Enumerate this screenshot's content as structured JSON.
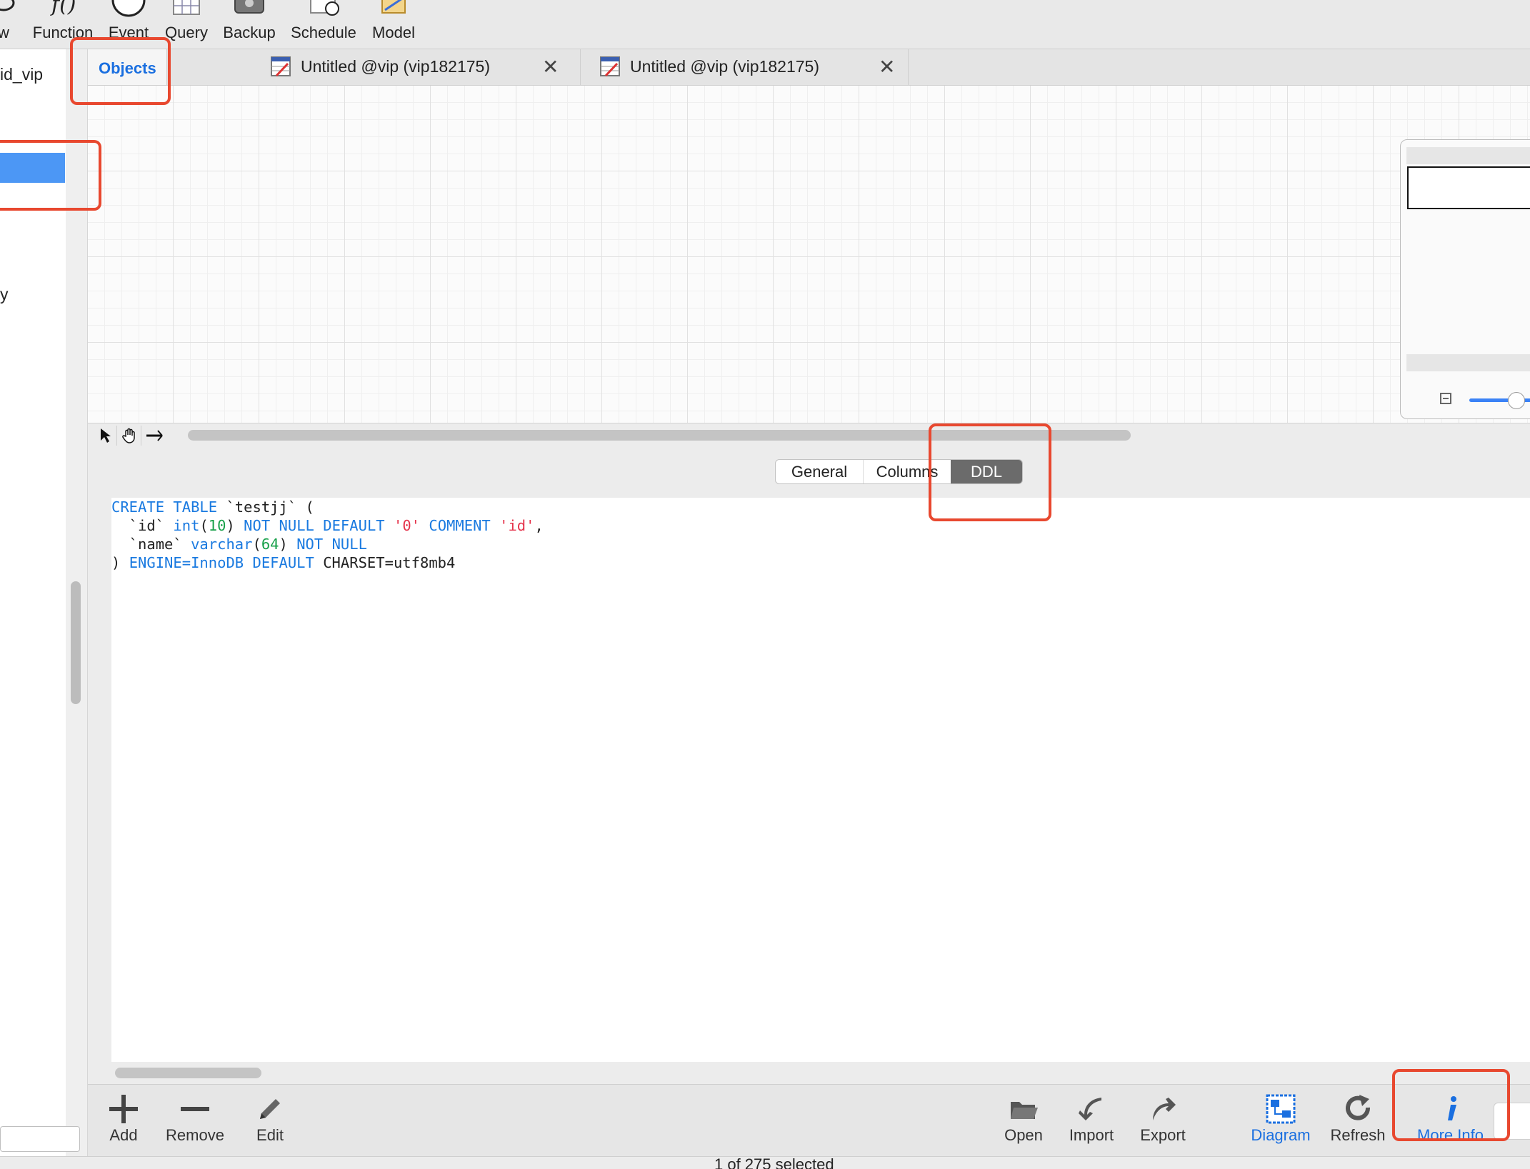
{
  "toolbar": {
    "items": [
      {
        "label": "w",
        "icon": "view-icon"
      },
      {
        "label": "Function",
        "icon": "function-icon"
      },
      {
        "label": "Event",
        "icon": "clock-icon"
      },
      {
        "label": "Query",
        "icon": "query-grid-icon"
      },
      {
        "label": "Backup",
        "icon": "backup-drive-icon"
      },
      {
        "label": "Schedule",
        "icon": "schedule-calendar-icon"
      },
      {
        "label": "Model",
        "icon": "model-ruler-icon"
      }
    ]
  },
  "sidebar": {
    "connection_label": "id_vip",
    "item_label": "y"
  },
  "tabs": [
    {
      "label": "Objects"
    },
    {
      "label": "Untitled @vip (vip182175)",
      "close": "✕"
    },
    {
      "label": "Untitled @vip (vip182175)",
      "close": "✕"
    }
  ],
  "segmented": {
    "general": "General",
    "columns": "Columns",
    "ddl": "DDL",
    "selected": "DDL"
  },
  "ddl": {
    "l1_kw": "CREATE TABLE",
    "l1_rest": " `testjj` (",
    "l2_col": "  `id` ",
    "l2_kw": "int",
    "l2_paren_open": "(",
    "l2_num": "10",
    "l2_paren_close": ") ",
    "l2_kw2": "NOT NULL DEFAULT",
    "l2_str": "'0'",
    "l2_kw3": "COMMENT",
    "l2_str2": "'id'",
    "l2_end": ",",
    "l3_col": "  `name` ",
    "l3_kw": "varchar",
    "l3_paren_open": "(",
    "l3_num": "64",
    "l3_paren_close": ") ",
    "l3_kw2": "NOT NULL",
    "l4_start": ") ",
    "l4_kw": "ENGINE=InnoDB DEFAULT",
    "l4_rest": " CHARSET=utf8mb4"
  },
  "bottom_bar": {
    "add": "Add",
    "remove": "Remove",
    "edit": "Edit",
    "open": "Open",
    "import": "Import",
    "export": "Export",
    "diagram": "Diagram",
    "refresh": "Refresh",
    "more_info": "More Info"
  },
  "status": {
    "text": "1 of 275 selected"
  },
  "colors": {
    "accent": "#1a6fe0",
    "selection": "#4c97f5",
    "highlight": "#e8482f",
    "keyword": "#1a7ae0",
    "number": "#18a04a",
    "string": "#e5334b"
  }
}
